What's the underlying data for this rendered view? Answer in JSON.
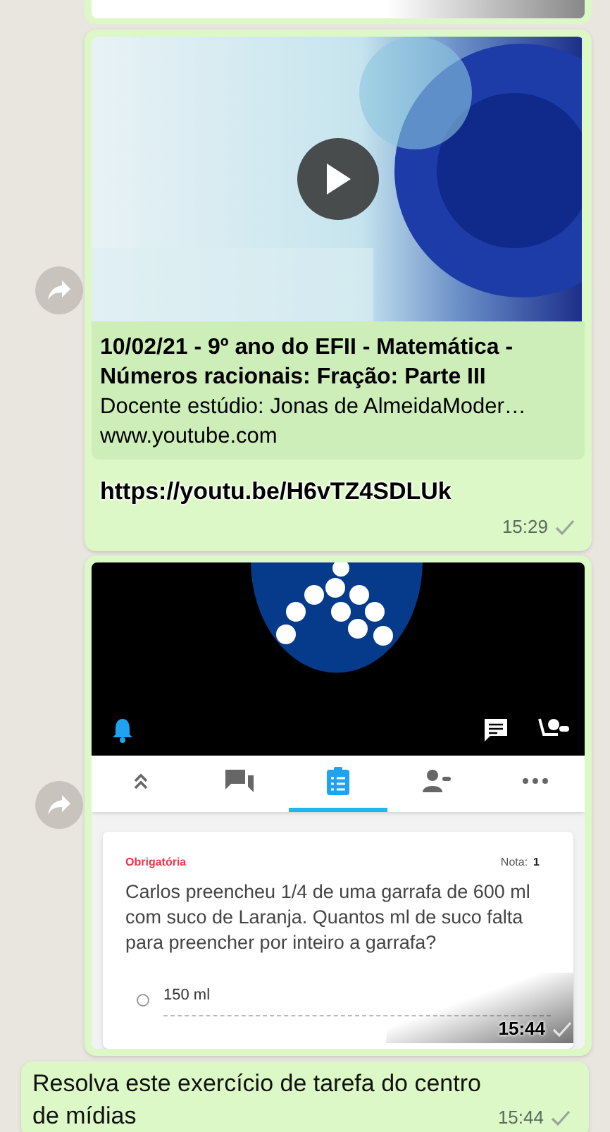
{
  "messages": [
    {
      "kind": "stub"
    },
    {
      "kind": "link",
      "forward": true,
      "preview": {
        "title": "10/02/21 - 9º ano do EFII - Matemática - Números racionais: Fração: Parte III",
        "description": "Docente estúdio: Jonas de AlmeidaModer…",
        "domain": "www.youtube.com"
      },
      "text": "https://youtu.be/H6vTZ4SDLUk",
      "time": "15:29",
      "read": false
    },
    {
      "kind": "screenshot",
      "forward": true,
      "time": "15:44",
      "read": false,
      "app": {
        "tabs": [
          {
            "kind": "collapse",
            "selected": false
          },
          {
            "kind": "chat",
            "selected": false
          },
          {
            "kind": "tasks",
            "selected": true
          },
          {
            "kind": "people",
            "selected": false
          },
          {
            "kind": "more",
            "selected": false
          }
        ],
        "card": {
          "required": "Obrigatória",
          "grade_label": "Nota:",
          "grade": "1",
          "question": "Carlos preencheu 1/4 de uma garrafa de 600 ml com suco de Laranja. Quantos ml de suco falta para preencher por inteiro a garrafa?",
          "options": [
            {
              "label": "150 ml",
              "selected": false
            }
          ]
        }
      }
    },
    {
      "kind": "text",
      "text": "Resolva este exercício de tarefa do centro de mídias",
      "time": "15:44",
      "read": false
    }
  ]
}
